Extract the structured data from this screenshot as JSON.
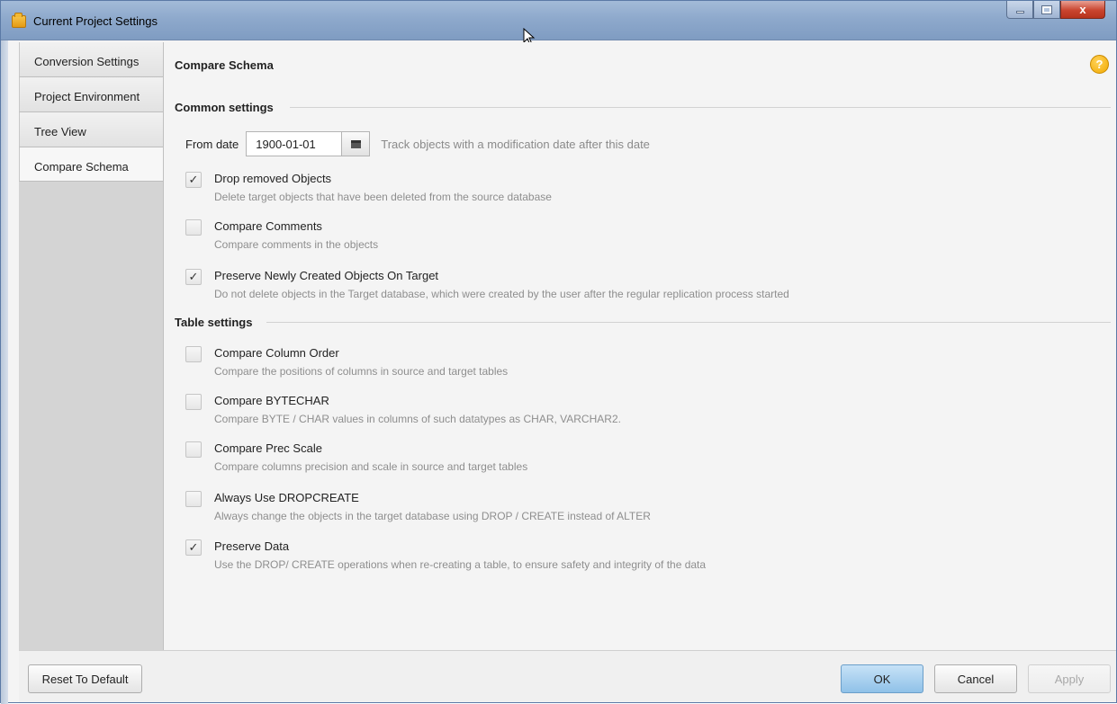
{
  "window": {
    "title": "Current Project Settings",
    "controls": {
      "minimize": "",
      "maximize": "",
      "close": "x"
    }
  },
  "sidebar": {
    "items": [
      {
        "label": "Conversion Settings",
        "active": false
      },
      {
        "label": "Project Environment",
        "active": false
      },
      {
        "label": "Tree View",
        "active": false
      },
      {
        "label": "Compare Schema",
        "active": true
      }
    ]
  },
  "content": {
    "title": "Compare Schema",
    "help_icon": "?",
    "common": {
      "header": "Common settings",
      "from_date": {
        "label": "From date",
        "value": "1900-01-01",
        "hint": "Track objects with a modification date after this date"
      },
      "options": [
        {
          "label": "Drop removed Objects",
          "desc": "Delete target objects that have been deleted from the source database",
          "checked": true
        },
        {
          "label": "Compare Comments",
          "desc": "Compare comments in the objects",
          "checked": false
        },
        {
          "label": "Preserve Newly Created Objects On Target",
          "desc": "Do not delete objects in the Target database, which were created by the user after the regular replication process started",
          "checked": true
        }
      ]
    },
    "table": {
      "header": "Table settings",
      "options": [
        {
          "label": "Compare Column Order",
          "desc": "Compare the positions of columns in source and target tables",
          "checked": false
        },
        {
          "label": "Compare BYTECHAR",
          "desc": "Compare BYTE / CHAR values in columns of such datatypes as CHAR, VARCHAR2.",
          "checked": false
        },
        {
          "label": "Compare Prec Scale",
          "desc": "Compare columns precision and scale in source and target tables",
          "checked": false
        },
        {
          "label": "Always Use DROPCREATE",
          "desc": "Always change the objects in the target database using DROP / CREATE instead of ALTER",
          "checked": false
        },
        {
          "label": "Preserve Data",
          "desc": "Use the DROP/ CREATE operations when re-creating a table, to ensure safety and integrity of the data",
          "checked": true
        }
      ]
    }
  },
  "footer": {
    "reset": "Reset To Default",
    "ok": "OK",
    "cancel": "Cancel",
    "apply": "Apply"
  },
  "icons": {
    "app": "folder-icon",
    "calendar": "calendar-icon",
    "help": "help-icon",
    "check": "check-icon"
  },
  "colors": {
    "titlebar": "#8ea9cc",
    "primary_button": "#8fc1e8",
    "help": "#f2a900"
  }
}
